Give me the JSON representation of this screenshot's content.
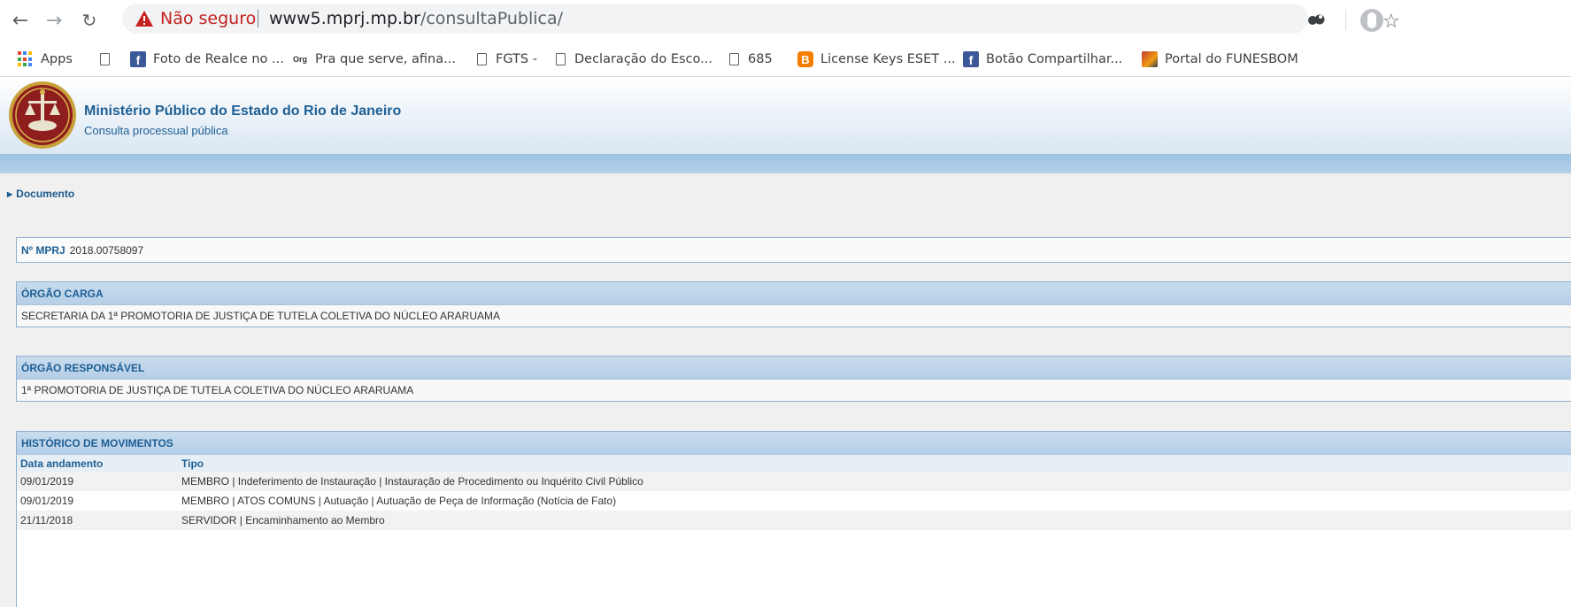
{
  "browser": {
    "insecure_label": "Não seguro",
    "url_host": "www5.mprj.mp.br",
    "url_path": "/consultaPublica/",
    "bookmarks": [
      {
        "label": "Apps",
        "icon": "apps-grid-icon"
      },
      {
        "label": "",
        "icon": "document-icon"
      },
      {
        "label": "Foto de Realce no ...",
        "icon": "facebook-icon"
      },
      {
        "label": "Pra que serve, afina...",
        "icon": "org-icon"
      },
      {
        "label": "FGTS -",
        "icon": "document-icon"
      },
      {
        "label": "Declaração do Esco...",
        "icon": "document-icon"
      },
      {
        "label": "685",
        "icon": "document-icon"
      },
      {
        "label": "License Keys ESET ...",
        "icon": "blogger-icon"
      },
      {
        "label": "Botão Compartilhar...",
        "icon": "facebook-icon"
      },
      {
        "label": "Portal do FUNESBOM",
        "icon": "portal-icon"
      }
    ]
  },
  "site": {
    "title": "Ministério Público do Estado do Rio de Janeiro",
    "subtitle": "Consulta processual pública"
  },
  "section_link": "Documento",
  "mprj": {
    "label": "Nº MPRJ",
    "value": "2018.00758097"
  },
  "orgao_carga": {
    "header": "ÓRGÃO CARGA",
    "value": "SECRETARIA DA 1ª PROMOTORIA DE JUSTIÇA DE TUTELA COLETIVA DO NÚCLEO ARARUAMA"
  },
  "orgao_responsavel": {
    "header": "ÓRGÃO RESPONSÁVEL",
    "value": "1ª PROMOTORIA DE JUSTIÇA DE TUTELA COLETIVA DO NÚCLEO ARARUAMA"
  },
  "historico": {
    "header": "HISTÓRICO DE MOVIMENTOS",
    "columns": [
      "Data andamento",
      "Tipo"
    ],
    "rows": [
      {
        "date": "09/01/2019",
        "tipo": "MEMBRO | Indeferimento de Instauração | Instauração de Procedimento ou Inquérito Civil Público"
      },
      {
        "date": "09/01/2019",
        "tipo": "MEMBRO | ATOS COMUNS | Autuação | Autuação de Peça de Informação (Notícia de Fato)"
      },
      {
        "date": "21/11/2018",
        "tipo": "SERVIDOR | Encaminhamento ao Membro"
      }
    ]
  },
  "colors": {
    "accent_blue": "#1d5f94",
    "insecure_red": "#c5221f",
    "header_band": "#9cc1e4"
  }
}
